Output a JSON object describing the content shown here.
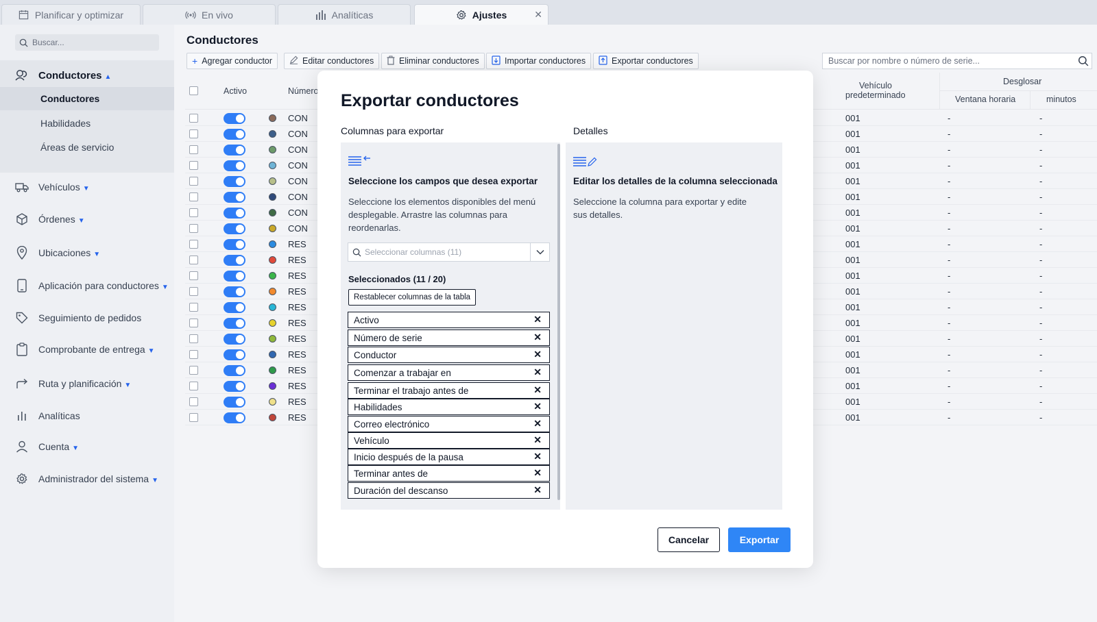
{
  "tabs": [
    {
      "label": "Planificar y optimizar",
      "icon": "calendar-icon"
    },
    {
      "label": "En vivo",
      "icon": "broadcast-icon"
    },
    {
      "label": "Analíticas",
      "icon": "bar-chart-icon"
    },
    {
      "label": "Ajustes",
      "icon": "gear-icon"
    }
  ],
  "sidebar": {
    "search_placeholder": "Buscar...",
    "items": [
      {
        "label": "Conductores"
      },
      {
        "label": "Vehículos"
      },
      {
        "label": "Órdenes"
      },
      {
        "label": "Ubicaciones"
      },
      {
        "label": "Aplicación para conductores"
      },
      {
        "label": "Seguimiento de pedidos"
      },
      {
        "label": "Comprobante de entrega"
      },
      {
        "label": "Ruta y planificación"
      },
      {
        "label": "Analíticas"
      },
      {
        "label": "Cuenta"
      },
      {
        "label": "Administrador del sistema"
      }
    ],
    "sub_items": [
      "Conductores",
      "Habilidades",
      "Áreas de servicio"
    ]
  },
  "page": {
    "title": "Conductores",
    "toolbar": {
      "add": "Agregar conductor",
      "edit": "Editar conductores",
      "delete": "Eliminar conductores",
      "import": "Importar conductores",
      "export": "Exportar conductores"
    },
    "search_placeholder": "Buscar por nombre o número de serie..."
  },
  "table": {
    "headers": {
      "active": "Activo",
      "number": "Número",
      "vehicle_line1": "Vehículo",
      "vehicle_line2": "predeterminado",
      "breakdown": "Desglosar",
      "time_window": "Ventana horaria",
      "minutes": "minutos"
    },
    "rows": [
      {
        "num": "CON",
        "color": "#8b6b5a",
        "vehicle": "001",
        "d1": "-",
        "d2": "-"
      },
      {
        "num": "CON",
        "color": "#3d5f8a",
        "vehicle": "001",
        "d1": "-",
        "d2": "-"
      },
      {
        "num": "CON",
        "color": "#6d9a6a",
        "vehicle": "001",
        "d1": "-",
        "d2": "-"
      },
      {
        "num": "CON",
        "color": "#6fb4d6",
        "vehicle": "001",
        "d1": "-",
        "d2": "-"
      },
      {
        "num": "CON",
        "color": "#b7bf8a",
        "vehicle": "001",
        "d1": "-",
        "d2": "-"
      },
      {
        "num": "CON",
        "color": "#2f4a7a",
        "vehicle": "001",
        "d1": "-",
        "d2": "-"
      },
      {
        "num": "CON",
        "color": "#3f6b45",
        "vehicle": "001",
        "d1": "-",
        "d2": "-"
      },
      {
        "num": "CON",
        "color": "#c9a82a",
        "vehicle": "001",
        "d1": "-",
        "d2": "-"
      },
      {
        "num": "RES",
        "color": "#2b8be0",
        "vehicle": "001",
        "d1": "-",
        "d2": "-"
      },
      {
        "num": "RES",
        "color": "#e04a3a",
        "vehicle": "001",
        "d1": "-",
        "d2": "-"
      },
      {
        "num": "RES",
        "color": "#3bb54a",
        "vehicle": "001",
        "d1": "-",
        "d2": "-"
      },
      {
        "num": "RES",
        "color": "#f28a2e",
        "vehicle": "001",
        "d1": "-",
        "d2": "-"
      },
      {
        "num": "RES",
        "color": "#29b6d6",
        "vehicle": "001",
        "d1": "-",
        "d2": "-"
      },
      {
        "num": "RES",
        "color": "#e6d22e",
        "vehicle": "001",
        "d1": "-",
        "d2": "-"
      },
      {
        "num": "RES",
        "color": "#8fb83a",
        "vehicle": "001",
        "d1": "-",
        "d2": "-"
      },
      {
        "num": "RES",
        "color": "#3168b0",
        "vehicle": "001",
        "d1": "-",
        "d2": "-"
      },
      {
        "num": "RES",
        "color": "#2f9a4a",
        "vehicle": "001",
        "d1": "-",
        "d2": "-"
      },
      {
        "num": "RES",
        "color": "#6a2fd6",
        "vehicle": "001",
        "d1": "-",
        "d2": "-"
      },
      {
        "num": "RES",
        "color": "#efe08a",
        "vehicle": "001",
        "d1": "-",
        "d2": "-"
      },
      {
        "num": "RES",
        "color": "#c0463a",
        "vehicle": "001",
        "d1": "-",
        "d2": "-"
      }
    ]
  },
  "modal": {
    "title": "Exportar conductores",
    "columns_label": "Columnas para exportar",
    "details_label": "Detalles",
    "left_heading": "Seleccione los campos que desea exportar",
    "left_text": "Seleccione los elementos disponibles del menú desplegable. Arrastre las columnas para reordenarlas.",
    "select_placeholder": "Seleccionar columnas (11)",
    "selected_count": "Seleccionados (11 / 20)",
    "reset_label": "Restablecer columnas de la tabla",
    "selected_columns": [
      "Activo",
      "Número de serie",
      "Conductor",
      "Comenzar a trabajar en",
      "Terminar el trabajo antes de",
      "Habilidades",
      "Correo electrónico",
      "Vehículo",
      "Inicio después de la pausa",
      "Terminar antes de",
      "Duración del descanso"
    ],
    "right_heading": "Editar los detalles de la columna seleccionada",
    "right_text": "Seleccione la columna para exportar y edite sus detalles.",
    "cancel_label": "Cancelar",
    "export_label": "Exportar"
  },
  "colors": {
    "accent": "#2f86f6",
    "toggle": "#2f7df6"
  }
}
